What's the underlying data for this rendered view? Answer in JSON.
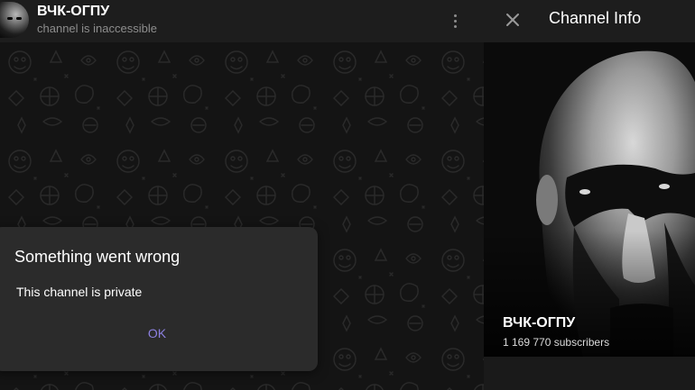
{
  "chat": {
    "title": "ВЧК-ОГПУ",
    "subtitle": "channel is inaccessible"
  },
  "dialog": {
    "title": "Something went wrong",
    "message": "This channel is private",
    "ok_label": "OK"
  },
  "info_panel": {
    "title": "Channel Info",
    "channel_name": "ВЧК-ОГПУ",
    "subscribers": "1 169 770 subscribers"
  },
  "icons": {
    "close": "close-icon",
    "more": "more-vertical-icon"
  },
  "colors": {
    "background": "#161616",
    "header": "#1d1d1d",
    "dialog": "#2b2b2b",
    "accent": "#8c80e0",
    "subtitle": "#8d8d8d"
  }
}
